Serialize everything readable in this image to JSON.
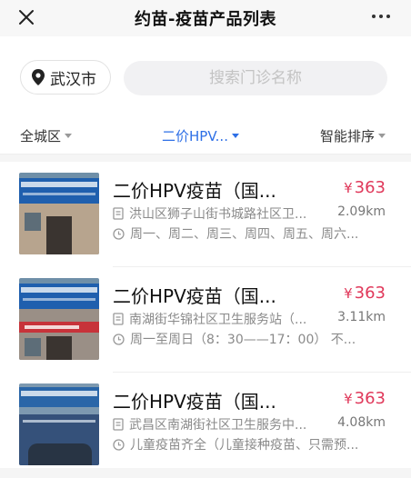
{
  "header": {
    "title": "约苗-疫苗产品列表"
  },
  "location": {
    "city": "武汉市"
  },
  "search": {
    "placeholder": "搜索门诊名称",
    "value": ""
  },
  "filters": {
    "district": "全城区",
    "product": "二价HPV...",
    "sort": "智能排序"
  },
  "clinics": [
    {
      "name": "二价HPV疫苗（国...",
      "price_symbol": "¥",
      "price": "363",
      "address": "洪山区狮子山街书城路社区卫...",
      "distance": "2.09km",
      "hours": "周一、周二、周三、周四、周五、周六..."
    },
    {
      "name": "二价HPV疫苗（国...",
      "price_symbol": "¥",
      "price": "363",
      "address": "南湖街华锦社区卫生服务站（...",
      "distance": "3.11km",
      "hours": "周一至周日（8：30——17：00）  不..."
    },
    {
      "name": "二价HPV疫苗（国...",
      "price_symbol": "¥",
      "price": "363",
      "address": "武昌区南湖街社区卫生服务中...",
      "distance": "4.08km",
      "hours": "儿童疫苗齐全（儿童接种疫苗、只需预..."
    }
  ],
  "colors": {
    "accent": "#2e6fe6",
    "price": "#e0385a"
  },
  "icons": {
    "close": "close-icon",
    "more": "more-icon",
    "location": "location-pin-icon",
    "address": "document-icon",
    "hours": "clock-icon"
  }
}
